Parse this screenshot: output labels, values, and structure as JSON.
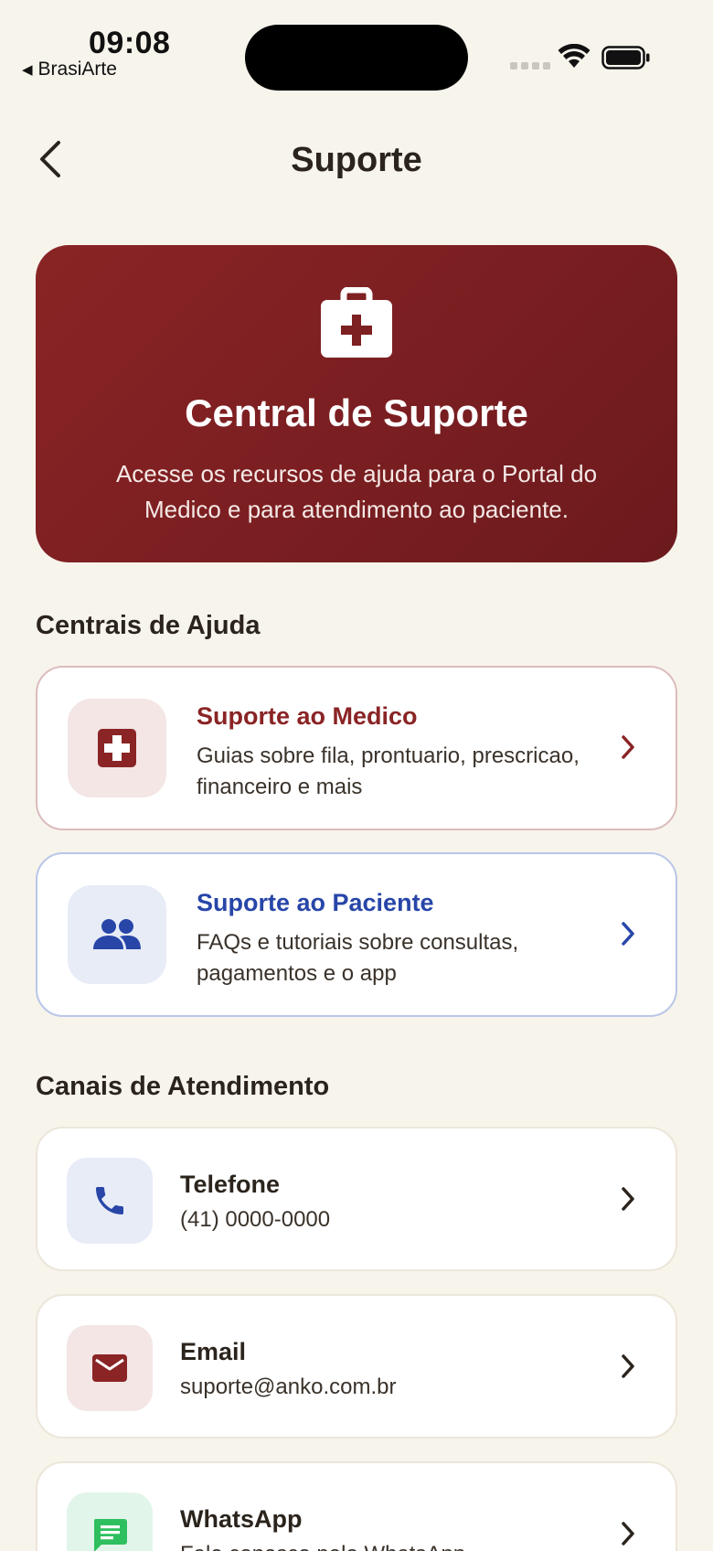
{
  "status_bar": {
    "time": "09:08",
    "back_app": "BrasiArte"
  },
  "nav": {
    "title": "Suporte"
  },
  "hero": {
    "icon": "medical-kit-icon",
    "title": "Central de Suporte",
    "description": "Acesse os recursos de ajuda para o Portal do Medico e para atendimento ao paciente."
  },
  "help_section": {
    "title": "Centrais de Ajuda",
    "cards": [
      {
        "title": "Suporte ao Medico",
        "description": "Guias sobre fila, prontuario, prescricao, financeiro e mais",
        "icon": "medical-cross-icon",
        "accent": "#8a2425"
      },
      {
        "title": "Suporte ao Paciente",
        "description": "FAQs e tutoriais sobre consultas, pagamentos e o app",
        "icon": "people-icon",
        "accent": "#2846a8"
      }
    ]
  },
  "channels_section": {
    "title": "Canais de Atendimento",
    "channels": [
      {
        "title": "Telefone",
        "value": "(41) 0000-0000",
        "icon": "phone-icon",
        "accent": "#2846a8"
      },
      {
        "title": "Email",
        "value": "suporte@anko.com.br",
        "icon": "mail-icon",
        "accent": "#8a2425"
      },
      {
        "title": "WhatsApp",
        "value": "Fale conosco pelo WhatsApp",
        "icon": "chat-icon",
        "accent": "#2fbf5f"
      }
    ]
  }
}
